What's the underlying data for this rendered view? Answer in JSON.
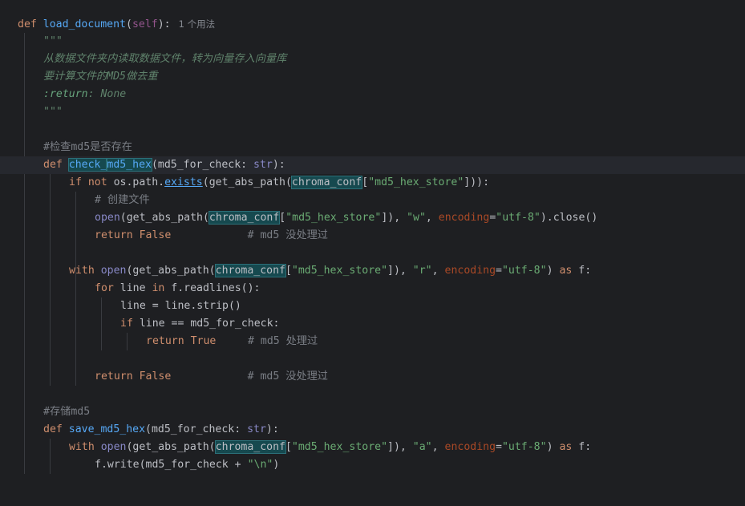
{
  "editor": {
    "language": "python",
    "lines": [
      {
        "tokens": [
          {
            "c": "kw",
            "t": "def "
          },
          {
            "c": "fn",
            "t": "load_document"
          },
          {
            "c": "",
            "t": "("
          },
          {
            "c": "self",
            "t": "self"
          },
          {
            "c": "",
            "t": "):"
          }
        ],
        "hint": "1 个用法"
      },
      {
        "tokens": [
          {
            "c": "doc",
            "t": "\"\"\""
          }
        ]
      },
      {
        "tokens": [
          {
            "c": "doc",
            "t": "从数据文件夹内读取数据文件，转为向量存入向量库"
          }
        ]
      },
      {
        "tokens": [
          {
            "c": "doc",
            "t": "要计算文件的MD5做去重"
          }
        ]
      },
      {
        "tokens": [
          {
            "c": "doctag",
            "t": ":return"
          },
          {
            "c": "doc",
            "t": ": None"
          }
        ]
      },
      {
        "tokens": [
          {
            "c": "doc",
            "t": "\"\"\""
          }
        ]
      },
      {
        "tokens": []
      },
      {
        "tokens": [
          {
            "c": "cm",
            "t": "#检查md5是否存在"
          }
        ]
      },
      {
        "tokens": [
          {
            "c": "kw",
            "t": "def "
          },
          {
            "c": "fn hl",
            "t": "check_"
          },
          {
            "c": "caret",
            "t": ""
          },
          {
            "c": "fn hl",
            "t": "md5_hex"
          },
          {
            "c": "",
            "t": "(md5_for_check: "
          },
          {
            "c": "bi",
            "t": "str"
          },
          {
            "c": "",
            "t": "):"
          }
        ],
        "current": true
      },
      {
        "tokens": [
          {
            "c": "kw",
            "t": "if not "
          },
          {
            "c": "",
            "t": "os.path."
          },
          {
            "c": "link",
            "t": "exists"
          },
          {
            "c": "",
            "t": "(get_abs_path("
          },
          {
            "c": "hl",
            "t": "chroma_conf"
          },
          {
            "c": "",
            "t": "["
          },
          {
            "c": "str",
            "t": "\"md5_hex_store\""
          },
          {
            "c": "",
            "t": "])):"
          }
        ]
      },
      {
        "tokens": [
          {
            "c": "cm",
            "t": "# 创建文件"
          }
        ]
      },
      {
        "tokens": [
          {
            "c": "bi",
            "t": "open"
          },
          {
            "c": "",
            "t": "(get_abs_path("
          },
          {
            "c": "hl",
            "t": "chroma_conf"
          },
          {
            "c": "",
            "t": "["
          },
          {
            "c": "str",
            "t": "\"md5_hex_store\""
          },
          {
            "c": "",
            "t": "]), "
          },
          {
            "c": "str",
            "t": "\"w\""
          },
          {
            "c": "",
            "t": ", "
          },
          {
            "c": "param",
            "t": "encoding"
          },
          {
            "c": "",
            "t": "="
          },
          {
            "c": "str",
            "t": "\"utf-8\""
          },
          {
            "c": "",
            "t": ").close()"
          }
        ]
      },
      {
        "tokens": [
          {
            "c": "kw",
            "t": "return False"
          },
          {
            "c": "",
            "t": "            "
          },
          {
            "c": "cm",
            "t": "# md5 没处理过"
          }
        ]
      },
      {
        "tokens": []
      },
      {
        "tokens": [
          {
            "c": "kw",
            "t": "with "
          },
          {
            "c": "bi",
            "t": "open"
          },
          {
            "c": "",
            "t": "(get_abs_path("
          },
          {
            "c": "hl",
            "t": "chroma_conf"
          },
          {
            "c": "",
            "t": "["
          },
          {
            "c": "str",
            "t": "\"md5_hex_store\""
          },
          {
            "c": "",
            "t": "]), "
          },
          {
            "c": "str",
            "t": "\"r\""
          },
          {
            "c": "",
            "t": ", "
          },
          {
            "c": "param",
            "t": "encoding"
          },
          {
            "c": "",
            "t": "="
          },
          {
            "c": "str",
            "t": "\"utf-8\""
          },
          {
            "c": "",
            "t": ") "
          },
          {
            "c": "kw",
            "t": "as "
          },
          {
            "c": "",
            "t": "f:"
          }
        ]
      },
      {
        "tokens": [
          {
            "c": "kw",
            "t": "for "
          },
          {
            "c": "",
            "t": "line "
          },
          {
            "c": "kw",
            "t": "in "
          },
          {
            "c": "",
            "t": "f.readlines():"
          }
        ]
      },
      {
        "tokens": [
          {
            "c": "",
            "t": "line = line.strip()"
          }
        ]
      },
      {
        "tokens": [
          {
            "c": "kw",
            "t": "if "
          },
          {
            "c": "",
            "t": "line == md5_for_check:"
          }
        ]
      },
      {
        "tokens": [
          {
            "c": "kw",
            "t": "return True"
          },
          {
            "c": "",
            "t": "     "
          },
          {
            "c": "cm",
            "t": "# md5 处理过"
          }
        ]
      },
      {
        "tokens": []
      },
      {
        "tokens": [
          {
            "c": "kw",
            "t": "return False"
          },
          {
            "c": "",
            "t": "            "
          },
          {
            "c": "cm",
            "t": "# md5 没处理过"
          }
        ]
      },
      {
        "tokens": []
      },
      {
        "tokens": [
          {
            "c": "cm",
            "t": "#存储md5"
          }
        ]
      },
      {
        "tokens": [
          {
            "c": "kw",
            "t": "def "
          },
          {
            "c": "fn",
            "t": "save_md5_hex"
          },
          {
            "c": "",
            "t": "(md5_for_check: "
          },
          {
            "c": "bi",
            "t": "str"
          },
          {
            "c": "",
            "t": "):"
          }
        ]
      },
      {
        "tokens": [
          {
            "c": "kw",
            "t": "with "
          },
          {
            "c": "bi",
            "t": "open"
          },
          {
            "c": "",
            "t": "(get_abs_path("
          },
          {
            "c": "hl",
            "t": "chroma_conf"
          },
          {
            "c": "",
            "t": "["
          },
          {
            "c": "str",
            "t": "\"md5_hex_store\""
          },
          {
            "c": "",
            "t": "]), "
          },
          {
            "c": "str",
            "t": "\"a\""
          },
          {
            "c": "",
            "t": ", "
          },
          {
            "c": "param",
            "t": "encoding"
          },
          {
            "c": "",
            "t": "="
          },
          {
            "c": "str",
            "t": "\"utf-8\""
          },
          {
            "c": "",
            "t": ") "
          },
          {
            "c": "kw",
            "t": "as "
          },
          {
            "c": "",
            "t": "f:"
          }
        ]
      },
      {
        "tokens": [
          {
            "c": "",
            "t": "f.write(md5_for_check + "
          },
          {
            "c": "str",
            "t": "\"\\n\""
          },
          {
            "c": "",
            "t": ")"
          }
        ]
      }
    ]
  }
}
